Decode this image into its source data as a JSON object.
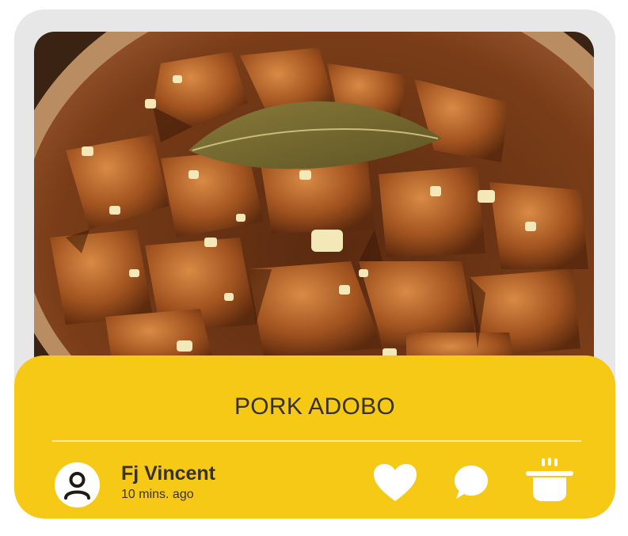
{
  "recipe": {
    "title": "PORK ADOBO",
    "author_name": "Fj Vincent",
    "posted_time": "10 mins. ago"
  },
  "actions": {
    "like_icon": "heart-icon",
    "comment_icon": "speech-bubble-icon",
    "cook_icon": "cooking-pot-icon"
  },
  "colors": {
    "card_background": "#e7e7e7",
    "panel_yellow": "#f5c915",
    "text_dark": "#3a3220",
    "icon_white": "#ffffff"
  }
}
